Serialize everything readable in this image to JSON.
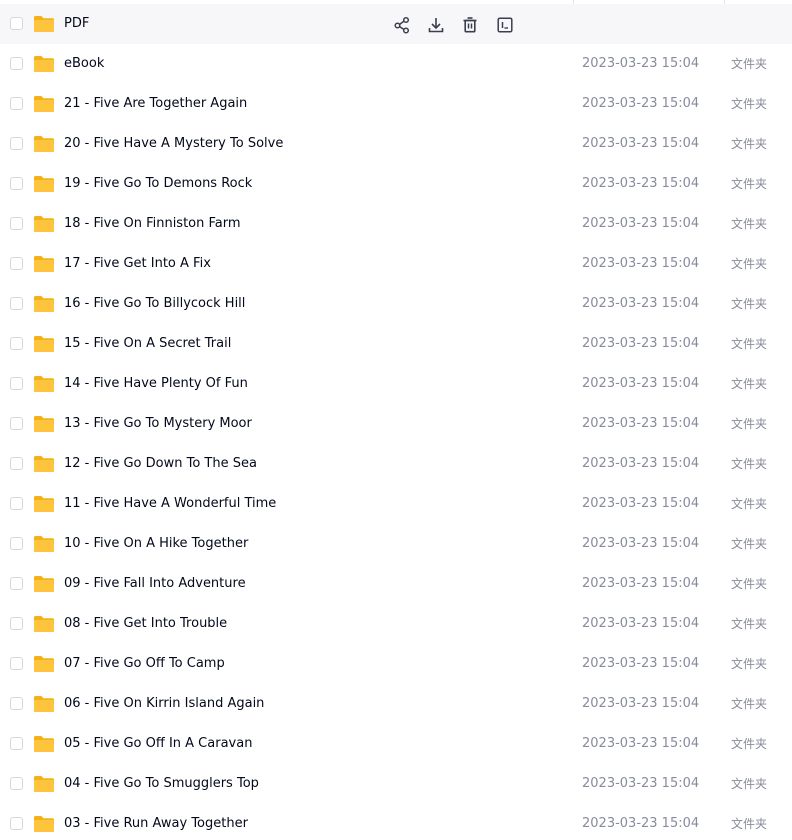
{
  "row_actions": [
    {
      "name": "share",
      "icon": "share-icon"
    },
    {
      "name": "download",
      "icon": "download-icon"
    },
    {
      "name": "delete",
      "icon": "trash-icon"
    },
    {
      "name": "rename",
      "icon": "rename-icon"
    }
  ],
  "colors": {
    "folder": "#ffc43d",
    "folder_back": "#f5b218",
    "hover_bg": "#f7f7f9"
  },
  "files": [
    {
      "name": "PDF",
      "modified": "",
      "type": ""
    },
    {
      "name": "eBook",
      "modified": "2023-03-23 15:04",
      "type": "文件夹"
    },
    {
      "name": "21 - Five Are Together Again",
      "modified": "2023-03-23 15:04",
      "type": "文件夹"
    },
    {
      "name": "20 - Five Have A Mystery To Solve",
      "modified": "2023-03-23 15:04",
      "type": "文件夹"
    },
    {
      "name": "19 - Five Go To Demons Rock",
      "modified": "2023-03-23 15:04",
      "type": "文件夹"
    },
    {
      "name": "18 - Five On Finniston Farm",
      "modified": "2023-03-23 15:04",
      "type": "文件夹"
    },
    {
      "name": "17 - Five Get Into A Fix",
      "modified": "2023-03-23 15:04",
      "type": "文件夹"
    },
    {
      "name": "16 - Five Go To Billycock Hill",
      "modified": "2023-03-23 15:04",
      "type": "文件夹"
    },
    {
      "name": "15 - Five On A Secret Trail",
      "modified": "2023-03-23 15:04",
      "type": "文件夹"
    },
    {
      "name": "14 - Five Have Plenty Of Fun",
      "modified": "2023-03-23 15:04",
      "type": "文件夹"
    },
    {
      "name": "13 - Five Go To Mystery Moor",
      "modified": "2023-03-23 15:04",
      "type": "文件夹"
    },
    {
      "name": "12 - Five Go Down To The Sea",
      "modified": "2023-03-23 15:04",
      "type": "文件夹"
    },
    {
      "name": "11 - Five Have A Wonderful Time",
      "modified": "2023-03-23 15:04",
      "type": "文件夹"
    },
    {
      "name": "10 - Five On A Hike Together",
      "modified": "2023-03-23 15:04",
      "type": "文件夹"
    },
    {
      "name": "09 - Five Fall Into Adventure",
      "modified": "2023-03-23 15:04",
      "type": "文件夹"
    },
    {
      "name": "08 - Five Get Into Trouble",
      "modified": "2023-03-23 15:04",
      "type": "文件夹"
    },
    {
      "name": "07 - Five Go Off To Camp",
      "modified": "2023-03-23 15:04",
      "type": "文件夹"
    },
    {
      "name": "06 - Five On Kirrin Island Again",
      "modified": "2023-03-23 15:04",
      "type": "文件夹"
    },
    {
      "name": "05 - Five Go Off In A Caravan",
      "modified": "2023-03-23 15:04",
      "type": "文件夹"
    },
    {
      "name": "04 - Five Go To Smugglers Top",
      "modified": "2023-03-23 15:04",
      "type": "文件夹"
    },
    {
      "name": "03 - Five Run Away Together",
      "modified": "2023-03-23 15:04",
      "type": "文件夹"
    }
  ]
}
